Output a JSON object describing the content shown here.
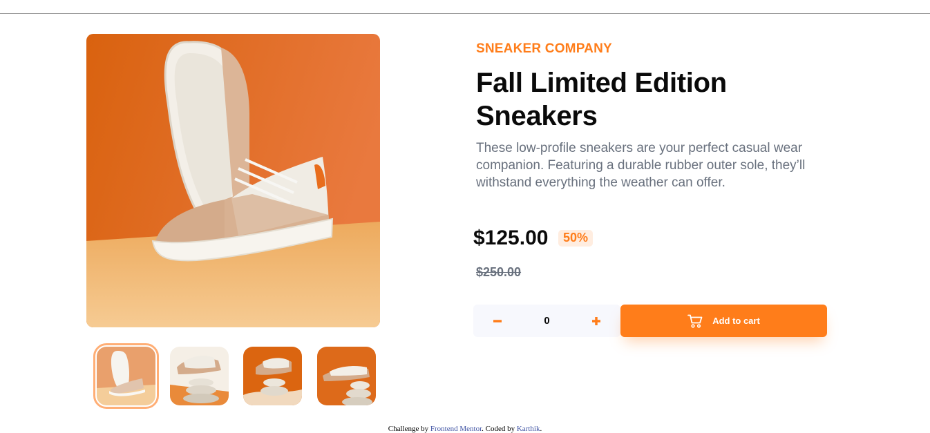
{
  "product": {
    "company": "SNEAKER COMPANY",
    "title": "Fall Limited Edition Sneakers",
    "description": "These low-profile sneakers are your perfect casual wear companion. Featuring a durable rubber outer sole, they’ll withstand everything the weather can offer.",
    "price": "$125.00",
    "discount": "50%",
    "original_price": "$250.00"
  },
  "gallery": {
    "main_image": "sneaker-product-photo-1",
    "thumbnails": [
      {
        "name": "thumbnail-1",
        "active": true
      },
      {
        "name": "thumbnail-2",
        "active": false
      },
      {
        "name": "thumbnail-3",
        "active": false
      },
      {
        "name": "thumbnail-4",
        "active": false
      }
    ]
  },
  "cart": {
    "quantity": "0",
    "minus_icon": "minus-icon",
    "plus_icon": "plus-icon",
    "cart_icon": "cart-icon",
    "add_label": "Add to cart"
  },
  "footer": {
    "prefix": "Challenge by ",
    "link1": "Frontend Mentor",
    "middle": ". Coded by ",
    "link2": "Karthik",
    "suffix": "."
  },
  "colors": {
    "accent": "#ff7d1a",
    "accent_pale": "#ffede0",
    "dark": "#0a0a0a",
    "text_grey": "#68707d"
  }
}
